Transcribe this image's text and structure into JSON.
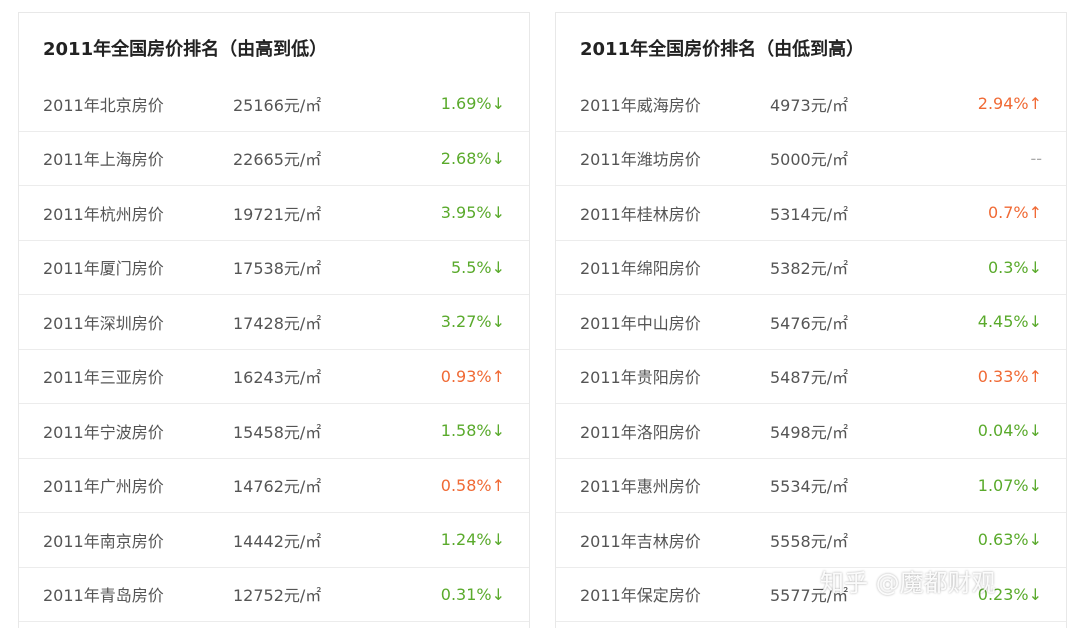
{
  "left_panel": {
    "title": "2011年全国房价排名（由高到低）",
    "rows": [
      {
        "city": "2011年北京房价",
        "price": "25166元/㎡",
        "change": "1.69%↓",
        "trend": "down"
      },
      {
        "city": "2011年上海房价",
        "price": "22665元/㎡",
        "change": "2.68%↓",
        "trend": "down"
      },
      {
        "city": "2011年杭州房价",
        "price": "19721元/㎡",
        "change": "3.95%↓",
        "trend": "down"
      },
      {
        "city": "2011年厦门房价",
        "price": "17538元/㎡",
        "change": "5.5%↓",
        "trend": "down"
      },
      {
        "city": "2011年深圳房价",
        "price": "17428元/㎡",
        "change": "3.27%↓",
        "trend": "down"
      },
      {
        "city": "2011年三亚房价",
        "price": "16243元/㎡",
        "change": "0.93%↑",
        "trend": "up"
      },
      {
        "city": "2011年宁波房价",
        "price": "15458元/㎡",
        "change": "1.58%↓",
        "trend": "down"
      },
      {
        "city": "2011年广州房价",
        "price": "14762元/㎡",
        "change": "0.58%↑",
        "trend": "up"
      },
      {
        "city": "2011年南京房价",
        "price": "14442元/㎡",
        "change": "1.24%↓",
        "trend": "down"
      },
      {
        "city": "2011年青岛房价",
        "price": "12752元/㎡",
        "change": "0.31%↓",
        "trend": "down"
      }
    ]
  },
  "right_panel": {
    "title": "2011年全国房价排名（由低到高）",
    "rows": [
      {
        "city": "2011年威海房价",
        "price": "4973元/㎡",
        "change": "2.94%↑",
        "trend": "up"
      },
      {
        "city": "2011年潍坊房价",
        "price": "5000元/㎡",
        "change": "--",
        "trend": "flat"
      },
      {
        "city": "2011年桂林房价",
        "price": "5314元/㎡",
        "change": "0.7%↑",
        "trend": "up"
      },
      {
        "city": "2011年绵阳房价",
        "price": "5382元/㎡",
        "change": "0.3%↓",
        "trend": "down"
      },
      {
        "city": "2011年中山房价",
        "price": "5476元/㎡",
        "change": "4.45%↓",
        "trend": "down"
      },
      {
        "city": "2011年贵阳房价",
        "price": "5487元/㎡",
        "change": "0.33%↑",
        "trend": "up"
      },
      {
        "city": "2011年洛阳房价",
        "price": "5498元/㎡",
        "change": "0.04%↓",
        "trend": "down"
      },
      {
        "city": "2011年惠州房价",
        "price": "5534元/㎡",
        "change": "1.07%↓",
        "trend": "down"
      },
      {
        "city": "2011年吉林房价",
        "price": "5558元/㎡",
        "change": "0.63%↓",
        "trend": "down"
      },
      {
        "city": "2011年保定房价",
        "price": "5577元/㎡",
        "change": "0.23%↓",
        "trend": "down"
      }
    ]
  },
  "colors": {
    "down": "#5aaa2c",
    "up": "#f06a35",
    "flat": "#aaaaaa"
  },
  "watermark": "知乎 @魔都财观"
}
